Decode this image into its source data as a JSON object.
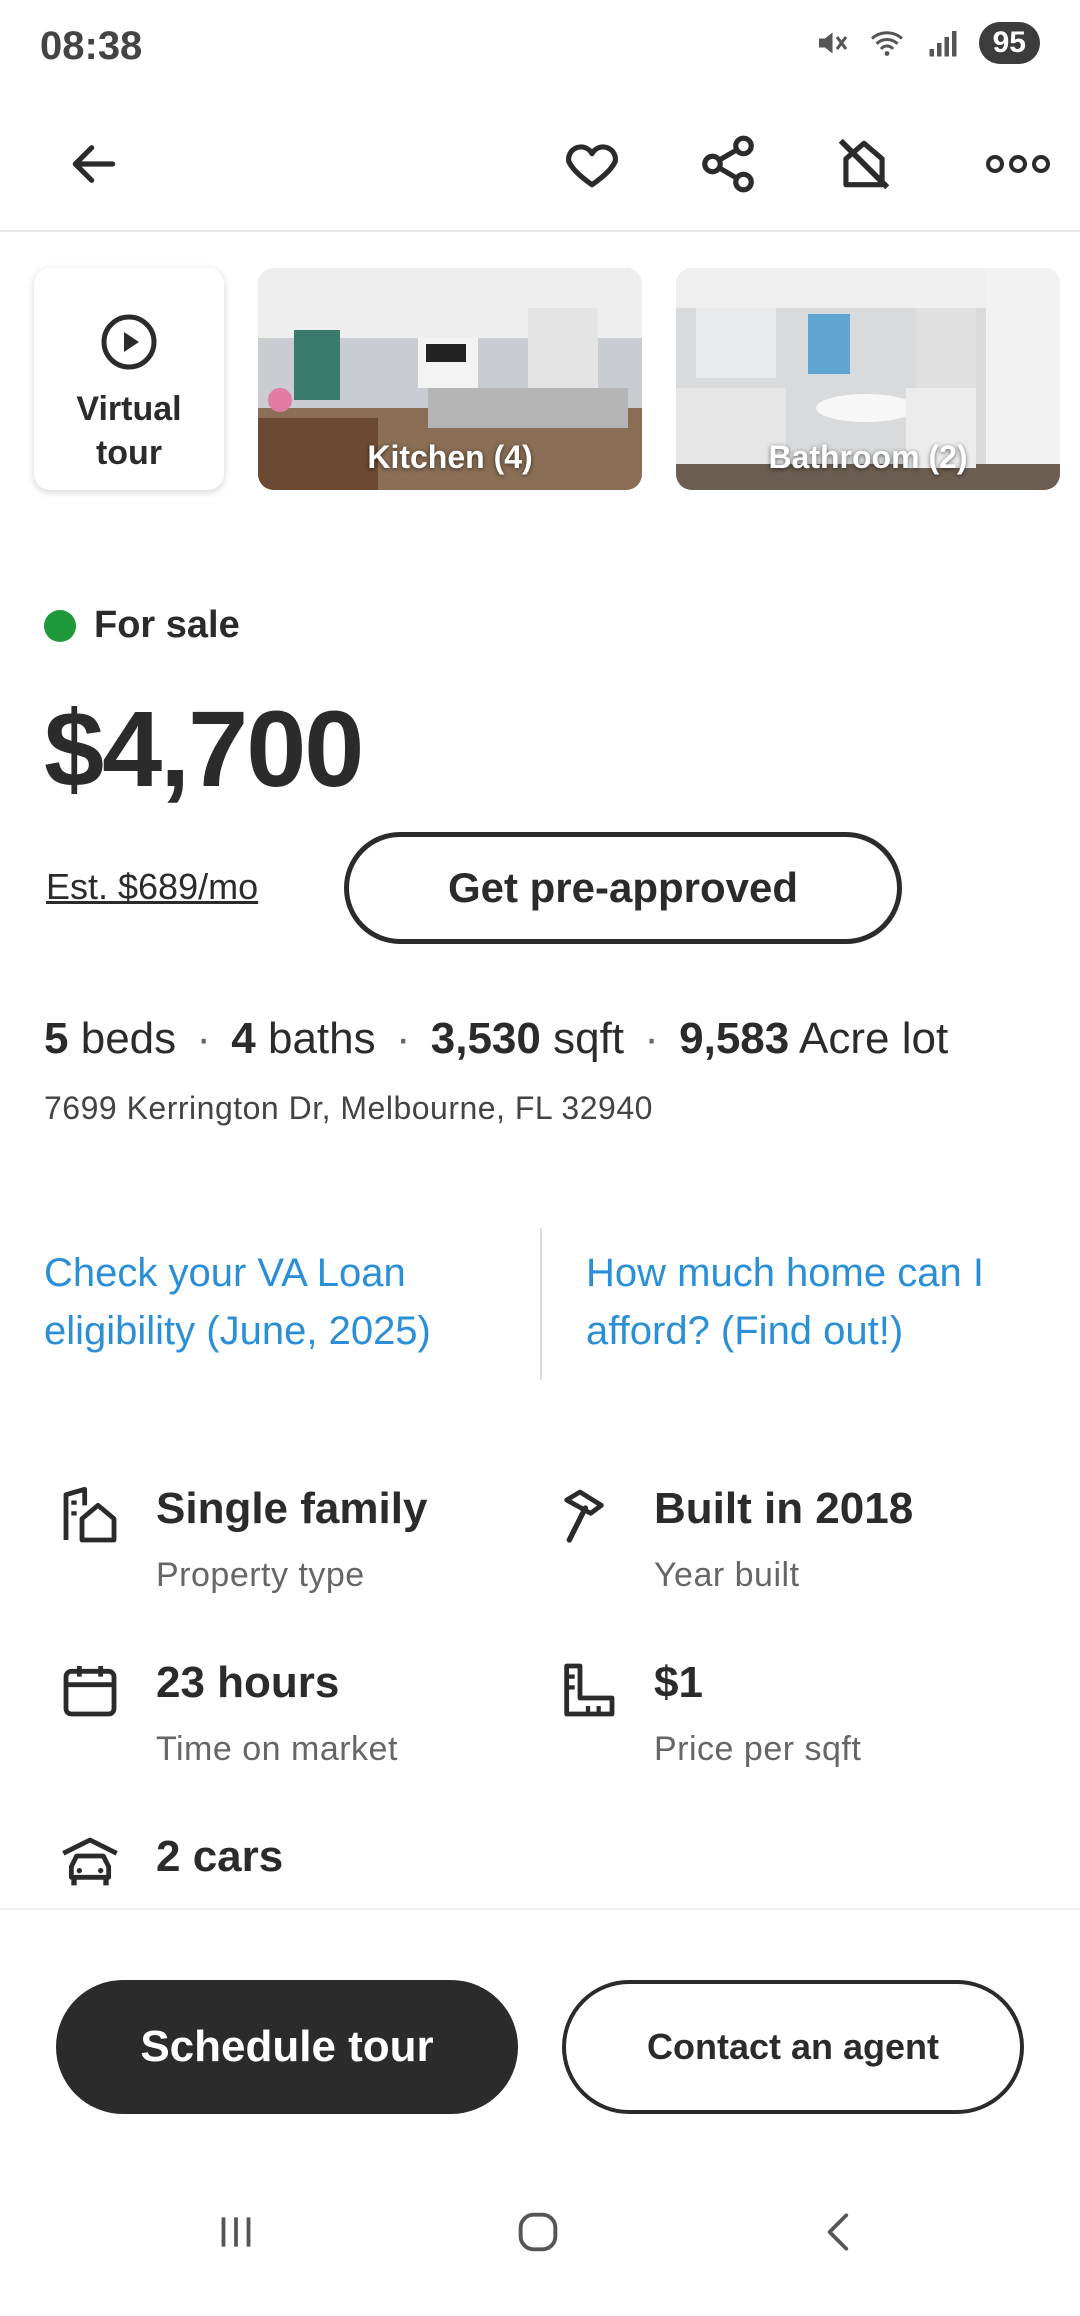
{
  "status_bar": {
    "time": "08:38",
    "battery": "95"
  },
  "nav": {
    "back": "back-arrow-icon",
    "favorite": "heart-icon",
    "share": "share-icon",
    "hide": "hide-home-icon",
    "more": "more-options-icon"
  },
  "media": {
    "virtual_tour_label": "Virtual\ntour",
    "photos": [
      {
        "label": "Kitchen (4)"
      },
      {
        "label": "Bathroom (2)"
      }
    ]
  },
  "listing": {
    "status": "For sale",
    "status_color": "#1f9a3a",
    "price": "$4,700",
    "est_payment": "Est. $689/mo",
    "preapproved_button": "Get pre-approved",
    "beds_value": "5",
    "beds_label": "beds",
    "baths_value": "4",
    "baths_label": "baths",
    "sqft_value": "3,530",
    "sqft_label": "sqft",
    "lot_value": "9,583",
    "lot_label": "Acre lot",
    "address": "7699 Kerrington Dr, Melbourne, FL 32940"
  },
  "links": {
    "va_loan": "Check your VA Loan\neligibility (June, 2025)",
    "afford": "How much home can I\nafford? (Find out!)",
    "link_color": "#2b8fd8"
  },
  "details": [
    {
      "icon": "property-type-icon",
      "value": "Single family",
      "label": "Property type"
    },
    {
      "icon": "hammer-icon",
      "value": "Built in 2018",
      "label": "Year built"
    },
    {
      "icon": "calendar-icon",
      "value": "23 hours",
      "label": "Time on market"
    },
    {
      "icon": "ruler-icon",
      "value": "$1",
      "label": "Price per sqft"
    },
    {
      "icon": "car-icon",
      "value": "2 cars",
      "label": ""
    }
  ],
  "actions": {
    "schedule_tour": "Schedule tour",
    "contact_agent": "Contact an agent"
  },
  "system_nav": {
    "recents": "recents-icon",
    "home": "home-icon",
    "back": "system-back-icon"
  }
}
